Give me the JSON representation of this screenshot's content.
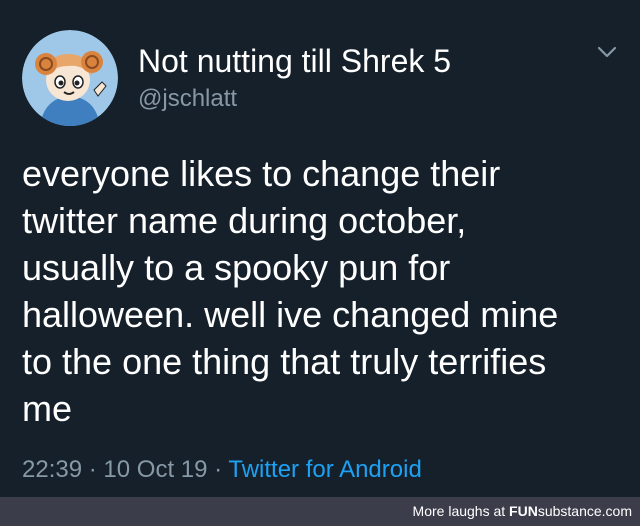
{
  "tweet": {
    "display_name": "Not nutting till Shrek 5",
    "handle": "@jschlatt",
    "text_lines": [
      "everyone likes to change their",
      "twitter name during october,",
      "usually to a spooky pun for",
      "halloween. well ive changed mine",
      "to the one thing that truly terrifies",
      "me"
    ],
    "time": "22:39",
    "separator": "·",
    "date": "10 Oct 19",
    "source": "Twitter for Android"
  },
  "footer": {
    "label": "More laughs at",
    "brand_fun": "FUN",
    "brand_sub": "substance.com"
  },
  "colors": {
    "background": "#15202b",
    "secondary_text": "#8899a6",
    "link": "#1da1f2",
    "footer_bg": "#3b3e4a"
  },
  "icons": {
    "avatar": "cartoon-ram-horn-character-avatar",
    "chevron": "chevron-down-icon"
  }
}
